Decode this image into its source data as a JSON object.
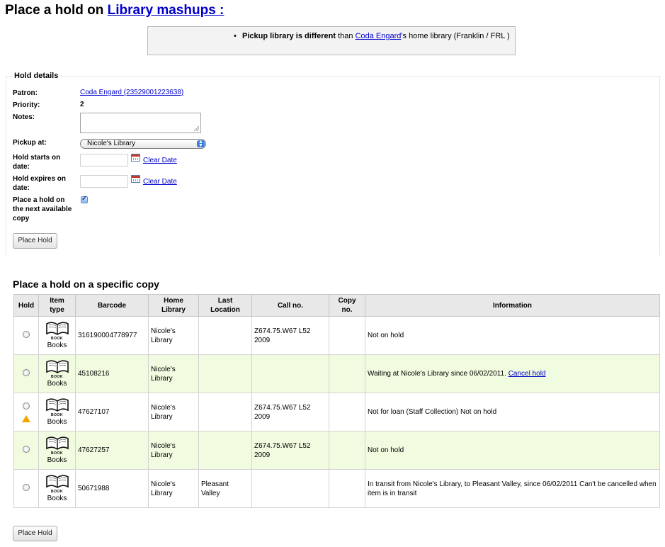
{
  "header": {
    "title_prefix": "Place a hold on ",
    "title_link": "Library mashups :"
  },
  "alert": {
    "bold": "Pickup library is different",
    "text_before": " than ",
    "patron_link": "Coda Engard",
    "text_after": "'s home library (Franklin / FRL )"
  },
  "hold_details": {
    "legend": "Hold details",
    "patron_label": "Patron:",
    "patron_value": "Coda Engard (23529001223638)",
    "priority_label": "Priority:",
    "priority_value": "2",
    "notes_label": "Notes:",
    "notes_value": "",
    "pickup_label": "Pickup at:",
    "pickup_value": "Nicole's Library",
    "starts_label": "Hold starts on date:",
    "expires_label": "Hold expires on date:",
    "clear_date": "Clear Date",
    "next_available_label": "Place a hold on the next available copy",
    "next_available_checked": true,
    "place_hold_button": "Place Hold"
  },
  "specific": {
    "title": "Place a hold on a specific copy",
    "columns": [
      "Hold",
      "Item type",
      "Barcode",
      "Home Library",
      "Last Location",
      "Call no.",
      "Copy no.",
      "Information"
    ],
    "book_icon_label": "BOOK",
    "rows": [
      {
        "item_type": "Books",
        "barcode": "316190004778977",
        "home": "Nicole's Library",
        "last": "",
        "call": "Z674.75.W67 L52 2009",
        "copy": "",
        "info": "Not on hold",
        "info_link": "",
        "warn": false
      },
      {
        "item_type": "Books",
        "barcode": "45108216",
        "home": "Nicole's Library",
        "last": "",
        "call": "",
        "copy": "",
        "info": "Waiting at Nicole's Library since 06/02/2011. ",
        "info_link": "Cancel hold",
        "warn": false
      },
      {
        "item_type": "Books",
        "barcode": "47627107",
        "home": "Nicole's Library",
        "last": "",
        "call": "Z674.75.W67 L52 2009",
        "copy": "",
        "info": "Not for loan (Staff Collection) Not on hold",
        "info_link": "",
        "warn": true
      },
      {
        "item_type": "Books",
        "barcode": "47627257",
        "home": "Nicole's Library",
        "last": "",
        "call": "Z674.75.W67 L52 2009",
        "copy": "",
        "info": "Not on hold",
        "info_link": "",
        "warn": false
      },
      {
        "item_type": "Books",
        "barcode": "50671988",
        "home": "Nicole's Library",
        "last": "Pleasant Valley",
        "call": "",
        "copy": "",
        "info": "In transit from Nicole's Library, to Pleasant Valley, since 06/02/2011 Can't be cancelled when item is in transit",
        "info_link": "",
        "warn": false
      }
    ],
    "place_hold_button": "Place Hold"
  }
}
